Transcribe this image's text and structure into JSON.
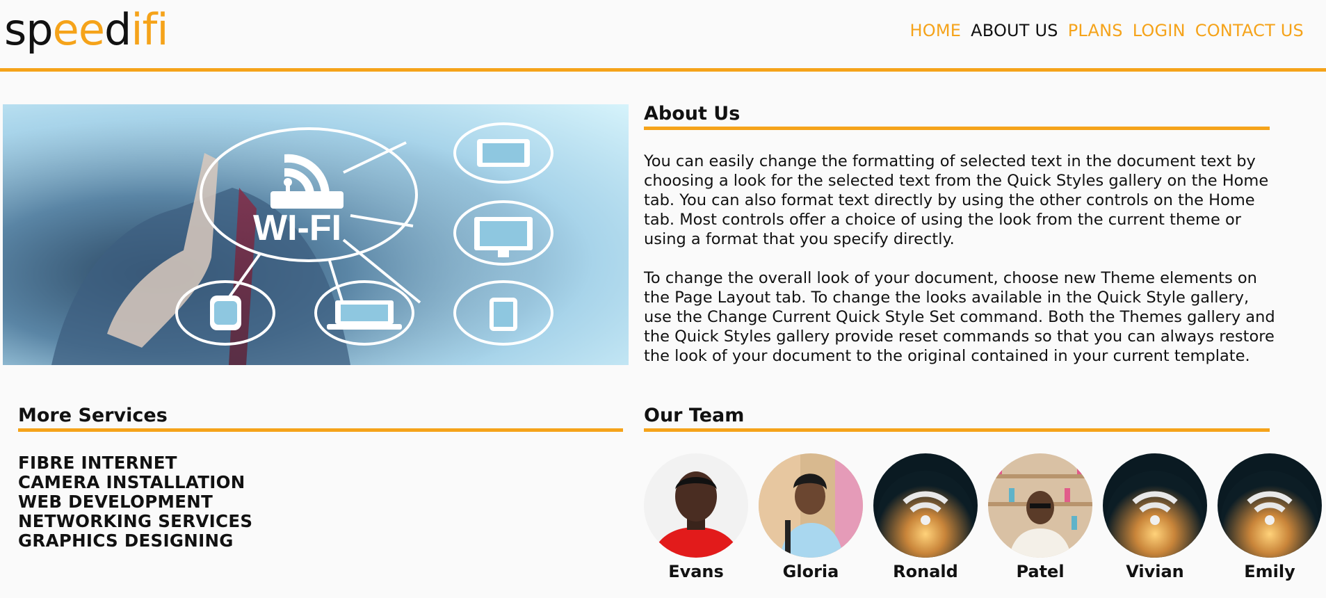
{
  "logo": {
    "part1": "sp",
    "part2": "ee",
    "part3": "d",
    "part4": "ifi"
  },
  "nav": {
    "items": [
      {
        "label": "HOME"
      },
      {
        "label": "ABOUT US"
      },
      {
        "label": "PLANS"
      },
      {
        "label": "LOGIN"
      },
      {
        "label": "CONTACT US"
      }
    ],
    "active": "ABOUT US"
  },
  "hero": {
    "wifi_text": "WI-FI"
  },
  "about": {
    "title": "About Us",
    "paragraphs": [
      "You can easily change the formatting of selected text in the document text by choosing a look for the selected text from the Quick Styles gallery on the Home tab. You can also format text directly by using the other controls on the Home tab. Most controls offer a choice of using the look from the current theme or using a format that you specify directly.",
      "To change the overall look of your document, choose new Theme elements on the Page Layout tab. To change the looks available in the Quick Style gallery, use the Change Current Quick Style Set command. Both the Themes gallery and the Quick Styles gallery provide reset commands so that you can always restore the look of your document to the original contained in your current template."
    ]
  },
  "services": {
    "title": "More Services",
    "items": [
      "FIBRE INTERNET",
      "CAMERA INSTALLATION",
      "WEB DEVELOPMENT",
      "NETWORKING SERVICES",
      "GRAPHICS DESIGNING"
    ]
  },
  "team": {
    "title": "Our Team",
    "members": [
      {
        "name": "Evans"
      },
      {
        "name": "Gloria"
      },
      {
        "name": "Ronald"
      },
      {
        "name": "Patel"
      },
      {
        "name": "Vivian"
      },
      {
        "name": "Emily"
      }
    ]
  },
  "colors": {
    "accent": "#f5a31a",
    "text": "#111111",
    "background": "#fafafa"
  }
}
